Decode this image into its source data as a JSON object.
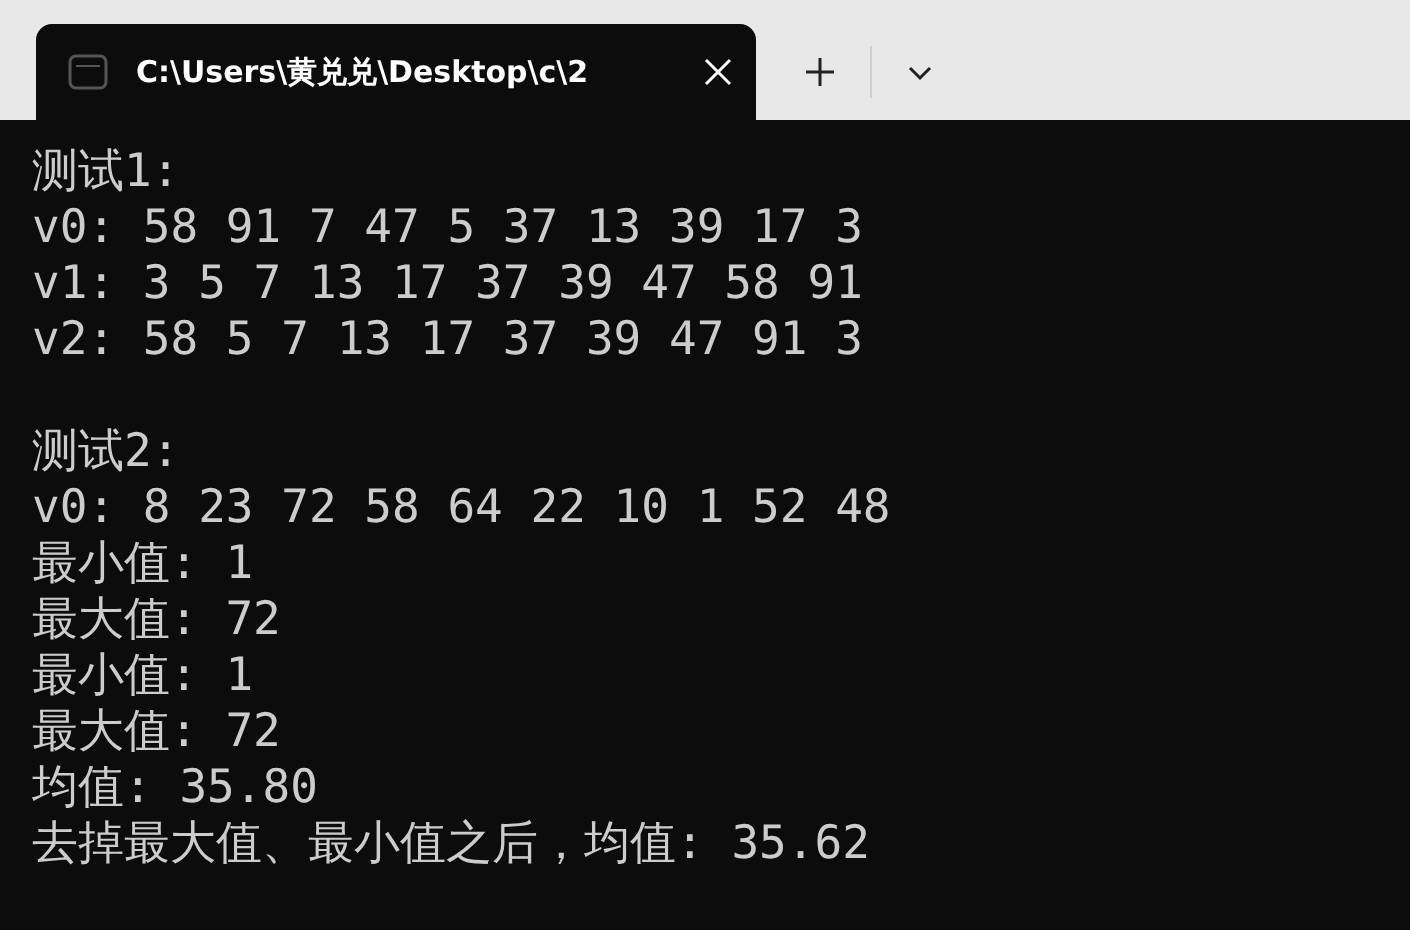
{
  "tab": {
    "title": "C:\\Users\\黄兑兑\\Desktop\\c\\2",
    "selected": true
  },
  "console": {
    "blocks": [
      [
        "测试1:",
        "v0: 58 91 7 47 5 37 13 39 17 3",
        "v1: 3 5 7 13 17 37 39 47 58 91",
        "v2: 58 5 7 13 17 37 39 47 91 3"
      ],
      [
        "测试2:",
        "v0: 8 23 72 58 64 22 10 1 52 48",
        "最小值: 1",
        "最大值: 72",
        "最小值: 1",
        "最大值: 72",
        "均值: 35.80",
        "去掉最大值、最小值之后，均值: 35.62"
      ]
    ]
  }
}
